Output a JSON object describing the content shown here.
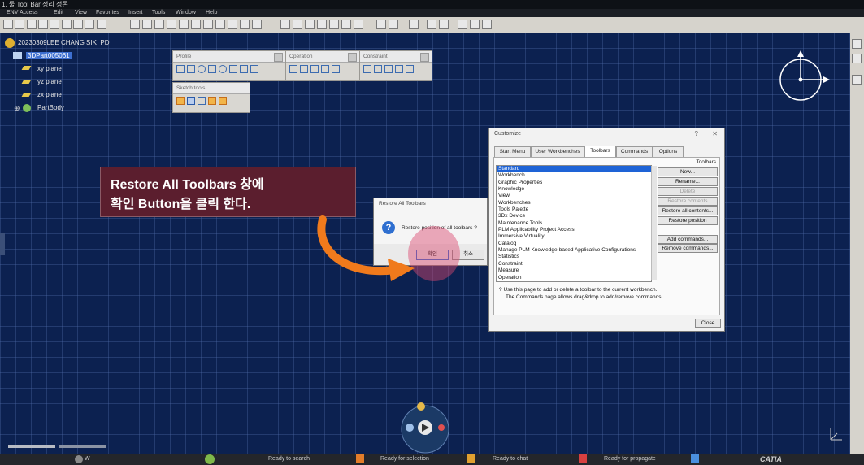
{
  "window": {
    "title": "1. 툴 Tool Bar 정리 정돈"
  },
  "menu": [
    "ENV Access",
    "Edit",
    "View",
    "Favorites",
    "Insert",
    "Tools",
    "Window",
    "Help"
  ],
  "tree": {
    "root": "20230309LEE CHANG SIK_PD",
    "part": "3DPart005061",
    "items": [
      "xy plane",
      "yz plane",
      "zx plane",
      "PartBody"
    ]
  },
  "toolbars": {
    "profile": "Profile",
    "operation": "Operation",
    "constraint": "Constraint",
    "sketch_tools": "Sketch tools"
  },
  "customize": {
    "title": "Customize",
    "help_btn": "?",
    "close_x": "✕",
    "tabs": [
      "Start Menu",
      "User Workbenches",
      "Toolbars",
      "Commands",
      "Options"
    ],
    "active_tab": "Toolbars",
    "list_header": "Toolbars",
    "list": [
      "Standard",
      "Workbench",
      "Graphic Properties",
      "Knowledge",
      "View",
      "Workbenches",
      "Tools Palette",
      "3Dx Device",
      "Maintenance Tools",
      "PLM Applicability Project Access",
      "Immersive Virtuality",
      "Catalog",
      "Manage PLM Knowledge-based Applicative Configurations",
      "Statistics",
      "Constraint",
      "Measure",
      "Operation"
    ],
    "buttons": {
      "new": "New...",
      "rename": "Rename...",
      "delete": "Delete",
      "restore_contents": "Restore contents",
      "restore_all": "Restore all contents...",
      "restore_position": "Restore position",
      "add_commands": "Add commands...",
      "remove_commands": "Remove commands...",
      "close": "Close"
    },
    "info_line1": "Use this page to add or delete a toolbar to the current workbench.",
    "info_line2": "The Commands page allows drag&drop to add/remove commands."
  },
  "restore_dialog": {
    "title": "Restore All Toolbars",
    "message": "Restore position of all toolbars ?",
    "ok": "확인",
    "cancel": "취소"
  },
  "callout": {
    "line1": "Restore All Toolbars 창에",
    "line2": "확인 Button을 클릭 한다."
  },
  "status": {
    "search": "Ready to search",
    "selection": "Ready for selection",
    "chat": "Ready to chat",
    "propagate": "Ready for propagate",
    "brand": "CATIA",
    "w": "W"
  },
  "colors": {
    "accent": "#1e63d6",
    "callout_bg": "#5b1e2e",
    "arrow": "#f07a1c"
  }
}
